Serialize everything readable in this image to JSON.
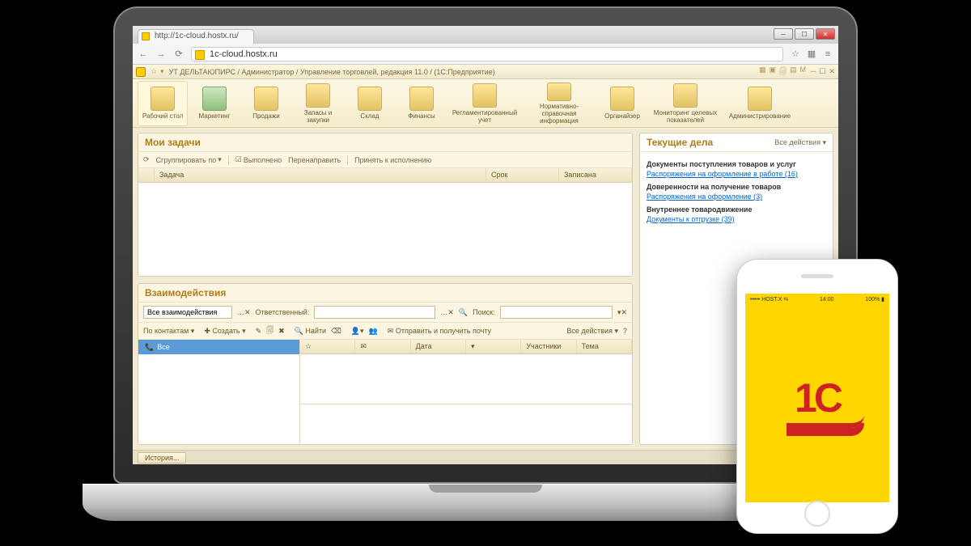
{
  "browser": {
    "tab_title": "http://1c-cloud.hostx.ru/",
    "url": "1c-cloud.hostx.ru"
  },
  "app": {
    "title": "УТ ДЕЛЬТАЮПИРС / Администратор / Управление торговлей, редакция 11.0 / (1С:Предприятие)",
    "toolbar": [
      {
        "label": "Рабочий стол"
      },
      {
        "label": "Маркетинг"
      },
      {
        "label": "Продажи"
      },
      {
        "label": "Запасы и закупки"
      },
      {
        "label": "Склад"
      },
      {
        "label": "Финансы"
      },
      {
        "label": "Регламентированный учет"
      },
      {
        "label": "Нормативно-справочная информация"
      },
      {
        "label": "Органайзер"
      },
      {
        "label": "Мониторинг целевых показателей"
      },
      {
        "label": "Администрирование"
      }
    ]
  },
  "tasks": {
    "title": "Мои задачи",
    "toolbar": {
      "group_by": "Сгруппировать по",
      "done": "Выполнено",
      "redirect": "Перенаправить",
      "accept": "Принять к исполнению"
    },
    "cols": {
      "task": "Задача",
      "deadline": "Срок",
      "written": "Записана"
    }
  },
  "interactions": {
    "title": "Взаимодействия",
    "filters": {
      "all_label": "Все взаимодействия",
      "responsible_label": "Ответственный:",
      "search_label": "Поиск:"
    },
    "toolbar": {
      "by_contacts": "По контактам",
      "create": "Создать",
      "find": "Найти",
      "send_receive": "Отправить и получить почту",
      "all_actions": "Все действия"
    },
    "tree_all": "Все",
    "cols": {
      "date": "Дата",
      "participants": "Участники",
      "subject": "Тема"
    }
  },
  "current_affairs": {
    "title": "Текущие дела",
    "all_actions": "Все действия",
    "sections": [
      {
        "heading": "Документы поступления товаров и услуг",
        "link": "Распоряжения на оформление в работе (16)"
      },
      {
        "heading": "Доверенности на получение товаров",
        "link": "Распоряжения на оформление (3)"
      },
      {
        "heading": "Внутреннее товародвижение",
        "link": "Документы к отгрузке (39)"
      }
    ]
  },
  "status": {
    "history": "История..."
  },
  "phone": {
    "carrier": "••••• HOST.X  ⇆",
    "time": "14:00",
    "battery": "100% ▮",
    "logo": "1С"
  }
}
